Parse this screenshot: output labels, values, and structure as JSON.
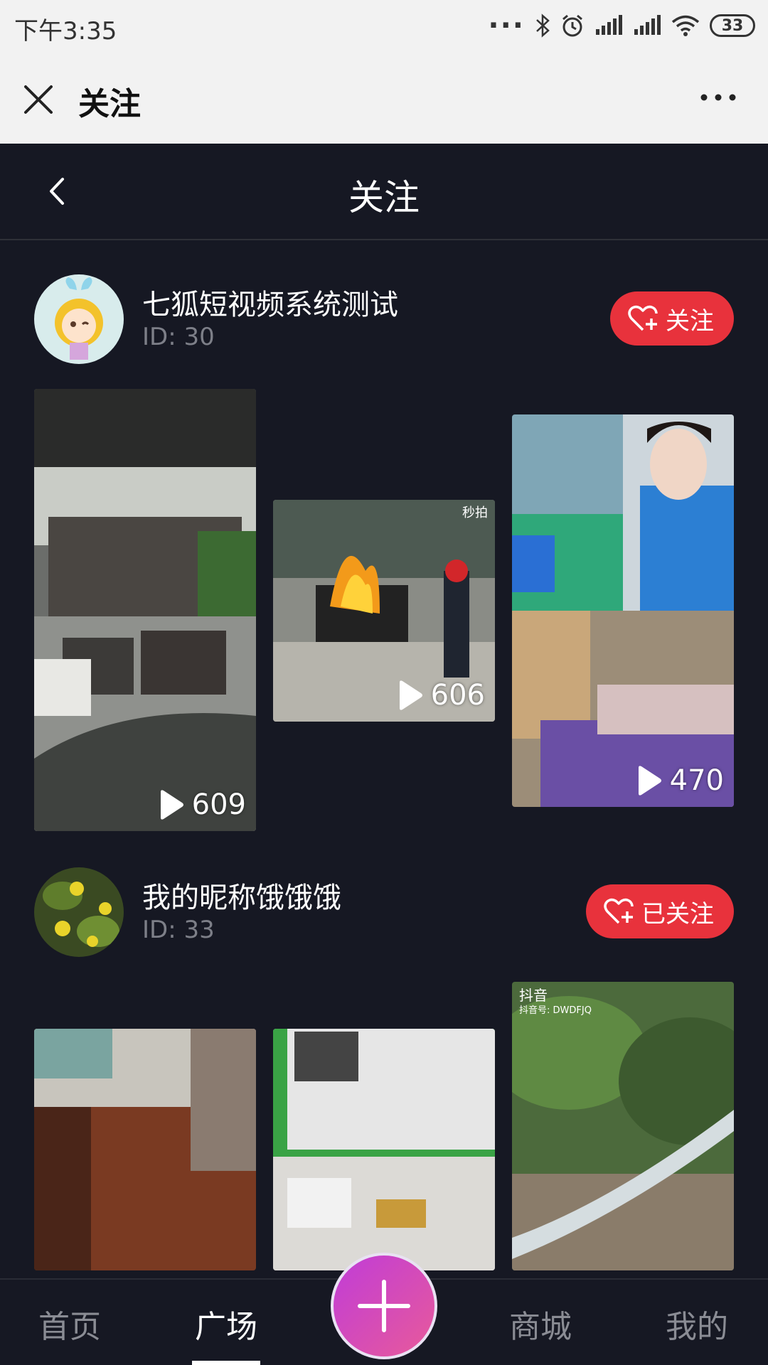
{
  "status_bar": {
    "time": "下午3:35",
    "battery": "33"
  },
  "webview": {
    "title": "关注"
  },
  "header": {
    "title": "关注"
  },
  "feed": [
    {
      "name": "七狐短视频系统测试",
      "id_label": "ID: 30",
      "follow_label": "关注",
      "videos": [
        {
          "plays": "609"
        },
        {
          "plays": "606",
          "watermark": "秒拍"
        },
        {
          "plays": "470"
        }
      ]
    },
    {
      "name": "我的昵称饿饿饿",
      "id_label": "ID: 33",
      "follow_label": "已关注",
      "videos": [
        {},
        {},
        {
          "watermark_line1": "抖音",
          "watermark_line2": "抖音号: DWDFJQ"
        }
      ]
    }
  ],
  "bottom_nav": {
    "home": "首页",
    "square": "广场",
    "mall": "商城",
    "mine": "我的"
  },
  "colors": {
    "background": "#161823",
    "accent_red": "#e8323c",
    "fab_gradient_start": "#c03cd8",
    "fab_gradient_end": "#e85a9a"
  },
  "icons": [
    "close-icon",
    "more-icon",
    "back-icon",
    "heart-plus-icon",
    "play-icon",
    "plus-icon",
    "bluetooth-icon",
    "alarm-icon",
    "signal-icon",
    "wifi-icon",
    "battery-icon"
  ]
}
